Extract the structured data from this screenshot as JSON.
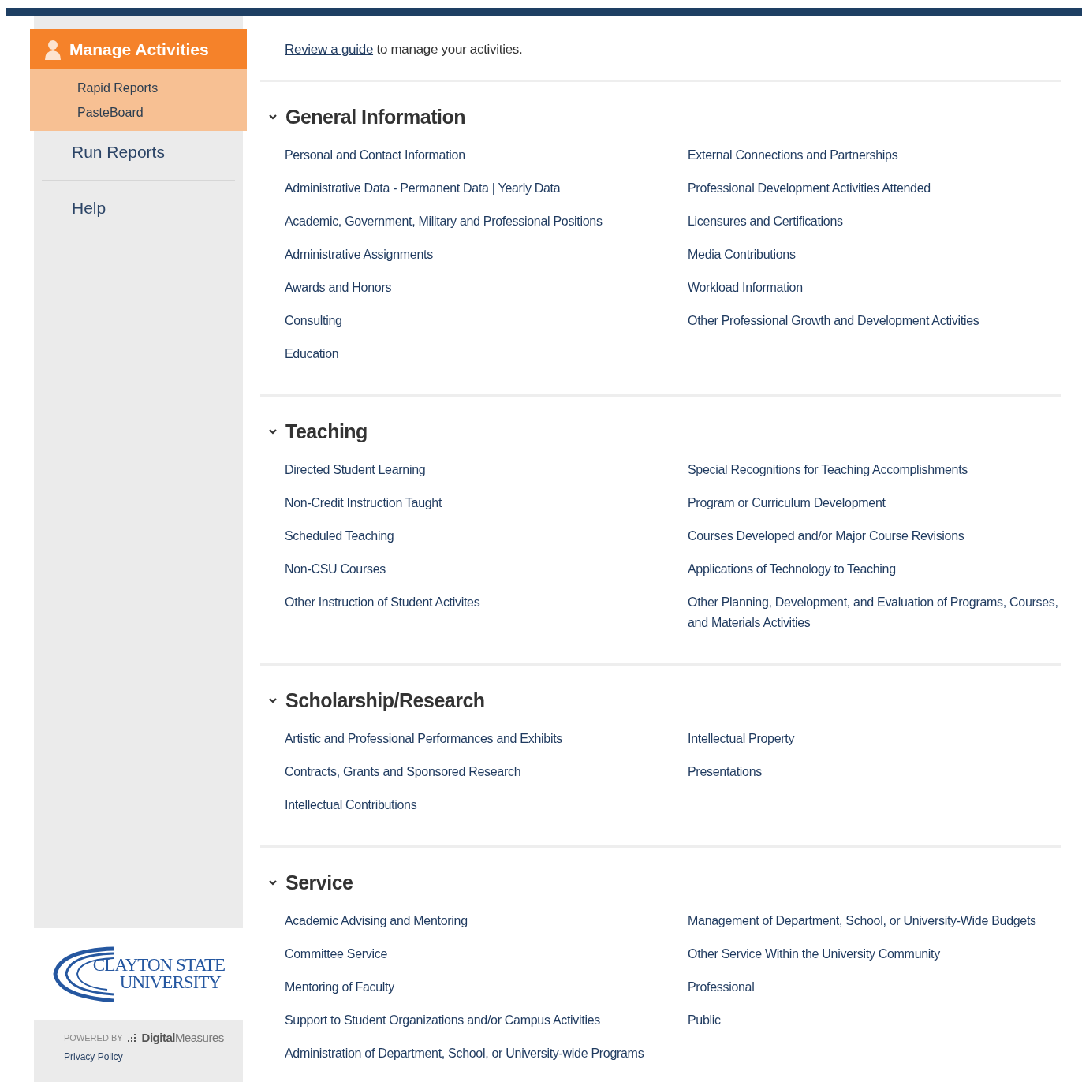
{
  "sidebar": {
    "items": [
      {
        "label": "Manage Activities",
        "selected": true,
        "children": [
          {
            "label": "Rapid Reports"
          },
          {
            "label": "PasteBoard"
          }
        ]
      },
      {
        "label": "Run Reports",
        "selected": false
      },
      {
        "label": "Help",
        "selected": false
      }
    ],
    "logo": {
      "line_1": "CLAYTON STATE",
      "line_2": "UNIVERSITY"
    },
    "powered_by": {
      "label": "POWERED BY",
      "brand": "**Digital**Measures"
    },
    "privacy_link": "Privacy Policy"
  },
  "intro": {
    "link": "Review a guide",
    "text": " to manage your activities."
  },
  "sections": [
    {
      "title": "General Information",
      "expanded": true,
      "columns": [
        [
          "Personal and Contact Information",
          "Administrative Data - Permanent Data | Yearly Data",
          "Academic, Government, Military and Professional Positions",
          "Administrative Assignments",
          "Awards and Honors",
          "Consulting",
          "Education"
        ],
        [
          "External Connections and Partnerships",
          "Professional Development Activities Attended",
          "Licensures and Certifications",
          "Media Contributions",
          "Workload Information",
          "Other Professional Growth and Development Activities"
        ]
      ]
    },
    {
      "title": "Teaching",
      "expanded": true,
      "columns": [
        [
          "Directed Student Learning",
          "Non-Credit Instruction Taught",
          "Scheduled Teaching",
          "Non-CSU Courses",
          "Other Instruction of Student Activites"
        ],
        [
          "Special Recognitions for Teaching Accomplishments",
          "Program or Curriculum Development",
          "Courses Developed and/or Major Course Revisions",
          "Applications of Technology to Teaching",
          "Other Planning, Development, and Evaluation of Programs, Courses, and Materials Activities"
        ]
      ]
    },
    {
      "title": "Scholarship/Research",
      "expanded": true,
      "columns": [
        [
          "Artistic and Professional Performances and Exhibits",
          "Contracts, Grants and Sponsored Research",
          "Intellectual Contributions"
        ],
        [
          "Intellectual Property",
          "Presentations"
        ]
      ]
    },
    {
      "title": "Service",
      "expanded": true,
      "columns": [
        [
          "Academic Advising and Mentoring",
          "Committee Service",
          "Mentoring of Faculty",
          "Support to Student Organizations and/or Campus Activities",
          "Administration of Department, School, or University-wide Programs"
        ],
        [
          "Management of Department, School, or University-Wide Budgets",
          "Other Service Within the University Community",
          "Professional",
          "Public"
        ]
      ]
    }
  ]
}
